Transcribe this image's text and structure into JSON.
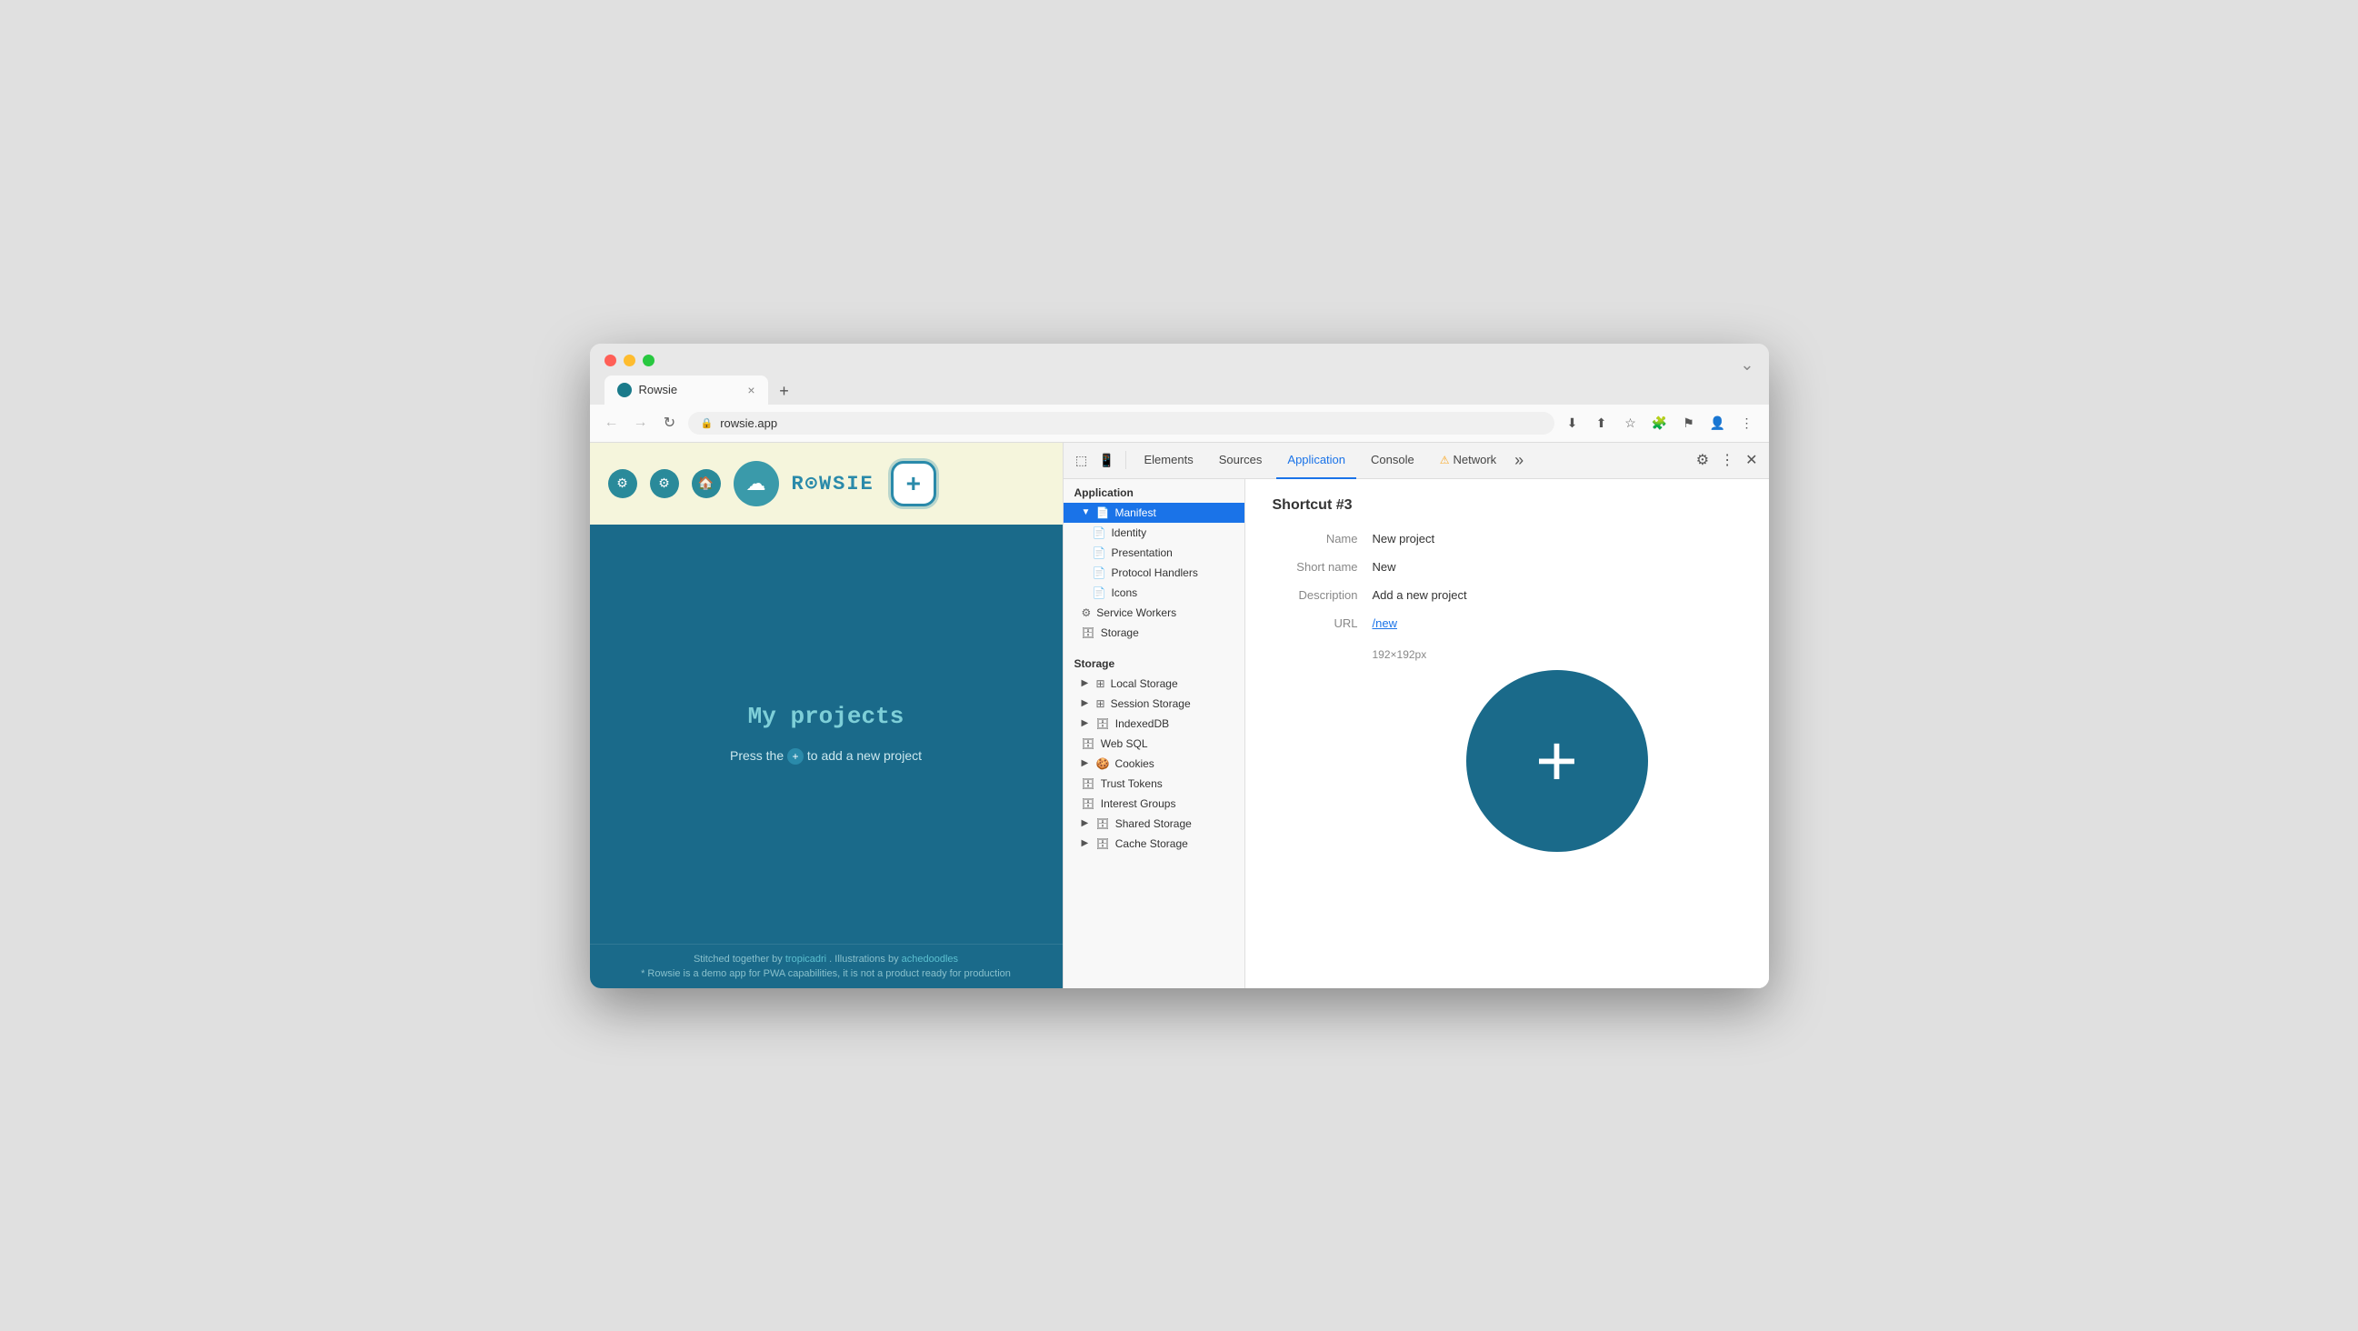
{
  "browser": {
    "tab_title": "Rowsie",
    "tab_close": "×",
    "tab_new": "+",
    "url": "rowsie.app",
    "expand_btn": "»"
  },
  "site": {
    "title": "My projects",
    "description_prefix": "Press the",
    "description_suffix": "to add a new project",
    "logo": "R⊙WSIE",
    "footer_text": "Stitched together by ",
    "footer_link1": "tropicadri",
    "footer_middle": ". Illustrations by ",
    "footer_link2": "achedoodles",
    "footer_note": "* Rowsie is a demo app for PWA capabilities, it is not a product ready for production"
  },
  "devtools": {
    "tabs": [
      {
        "id": "elements",
        "label": "Elements",
        "active": false
      },
      {
        "id": "sources",
        "label": "Sources",
        "active": false
      },
      {
        "id": "application",
        "label": "Application",
        "active": true
      },
      {
        "id": "console",
        "label": "Console",
        "active": false
      },
      {
        "id": "network",
        "label": "Network",
        "active": false,
        "warn": true
      }
    ],
    "more": "»",
    "sidebar": {
      "application_section": "Application",
      "application_items": [
        {
          "id": "manifest",
          "label": "Manifest",
          "expanded": true,
          "active": true,
          "indent": 0
        },
        {
          "id": "identity",
          "label": "Identity",
          "indent": 1
        },
        {
          "id": "presentation",
          "label": "Presentation",
          "indent": 1
        },
        {
          "id": "protocol-handlers",
          "label": "Protocol Handlers",
          "indent": 1
        },
        {
          "id": "icons",
          "label": "Icons",
          "indent": 1
        },
        {
          "id": "service-workers",
          "label": "Service Workers",
          "indent": 0
        },
        {
          "id": "storage-app",
          "label": "Storage",
          "indent": 0
        }
      ],
      "storage_section": "Storage",
      "storage_items": [
        {
          "id": "local-storage",
          "label": "Local Storage",
          "expandable": true
        },
        {
          "id": "session-storage",
          "label": "Session Storage",
          "expandable": true
        },
        {
          "id": "indexeddb",
          "label": "IndexedDB",
          "expandable": true
        },
        {
          "id": "web-sql",
          "label": "Web SQL",
          "expandable": false
        },
        {
          "id": "cookies",
          "label": "Cookies",
          "expandable": true
        },
        {
          "id": "trust-tokens",
          "label": "Trust Tokens",
          "expandable": false
        },
        {
          "id": "interest-groups",
          "label": "Interest Groups",
          "expandable": false
        },
        {
          "id": "shared-storage",
          "label": "Shared Storage",
          "expandable": true
        },
        {
          "id": "cache-storage",
          "label": "Cache Storage",
          "expandable": true
        }
      ]
    },
    "panel": {
      "title": "Shortcut #3",
      "fields": [
        {
          "label": "Name",
          "value": "New project",
          "type": "text"
        },
        {
          "label": "Short name",
          "value": "New",
          "type": "text"
        },
        {
          "label": "Description",
          "value": "Add a new project",
          "type": "text"
        },
        {
          "label": "URL",
          "value": "/new",
          "type": "link"
        }
      ],
      "icon_size": "192×192px"
    }
  }
}
